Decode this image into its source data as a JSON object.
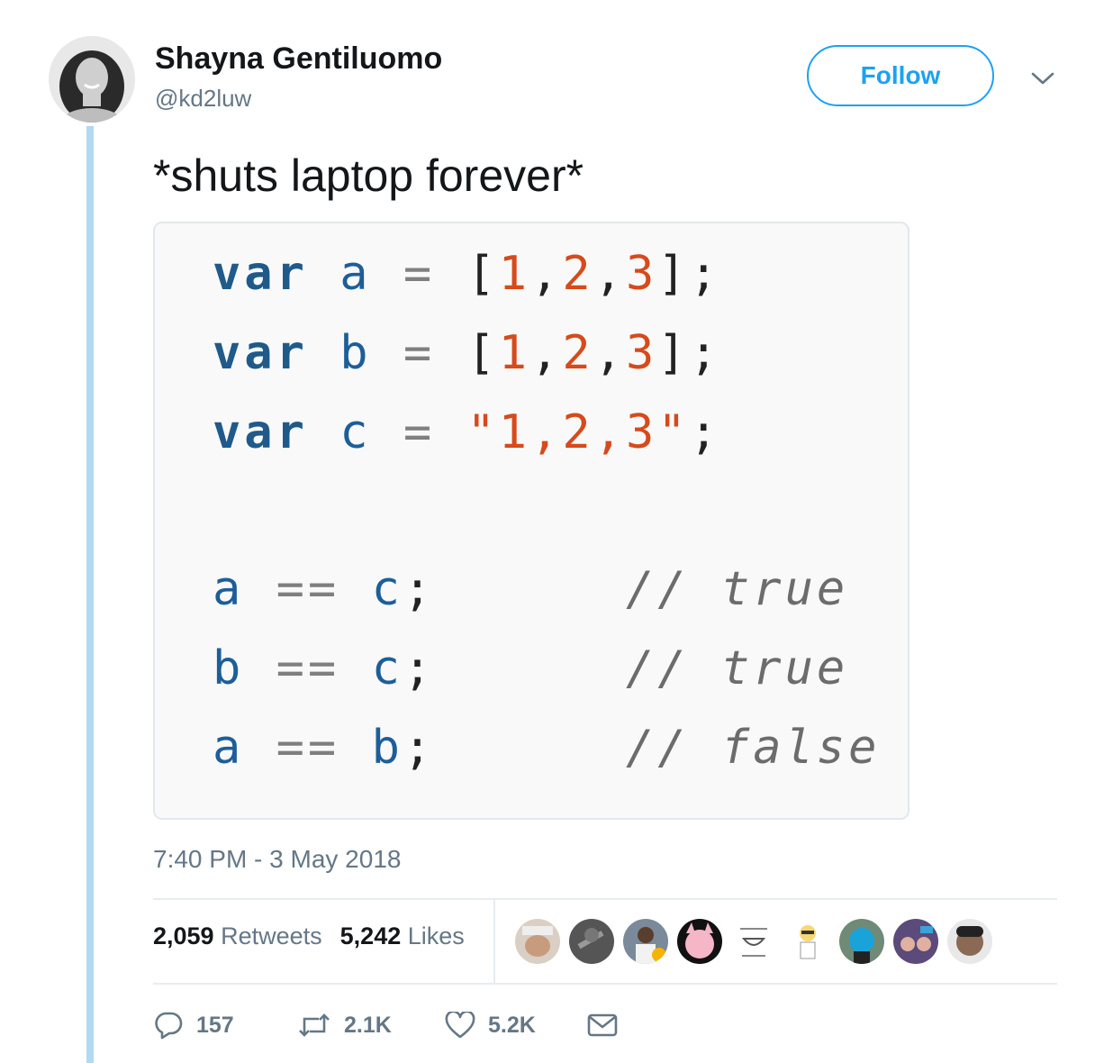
{
  "author": {
    "display_name": "Shayna Gentiluomo",
    "handle": "@kd2luw"
  },
  "follow_label": "Follow",
  "tweet_text": "*shuts laptop forever*",
  "code_image": {
    "lines": [
      "var a = [1,2,3];",
      "var b = [1,2,3];",
      "var c = \"1,2,3\";",
      "a == c;      // true",
      "b == c;      // true",
      "a == b;      // false"
    ]
  },
  "timestamp": "7:40 PM - 3 May 2018",
  "stats": {
    "retweets_count": "2,059",
    "retweets_label": "Retweets",
    "likes_count": "5,242",
    "likes_label": "Likes"
  },
  "likers_count": 9,
  "actions": {
    "reply_count": "157",
    "retweet_count": "2.1K",
    "like_count": "5.2K"
  },
  "colors": {
    "accent": "#1da1f2",
    "thread_line": "#b3d8f1",
    "keyword": "#1f5a8a",
    "number": "#d64a1b"
  },
  "icons": [
    "chevron-down-icon",
    "reply-icon",
    "retweet-icon",
    "heart-icon",
    "message-icon"
  ]
}
